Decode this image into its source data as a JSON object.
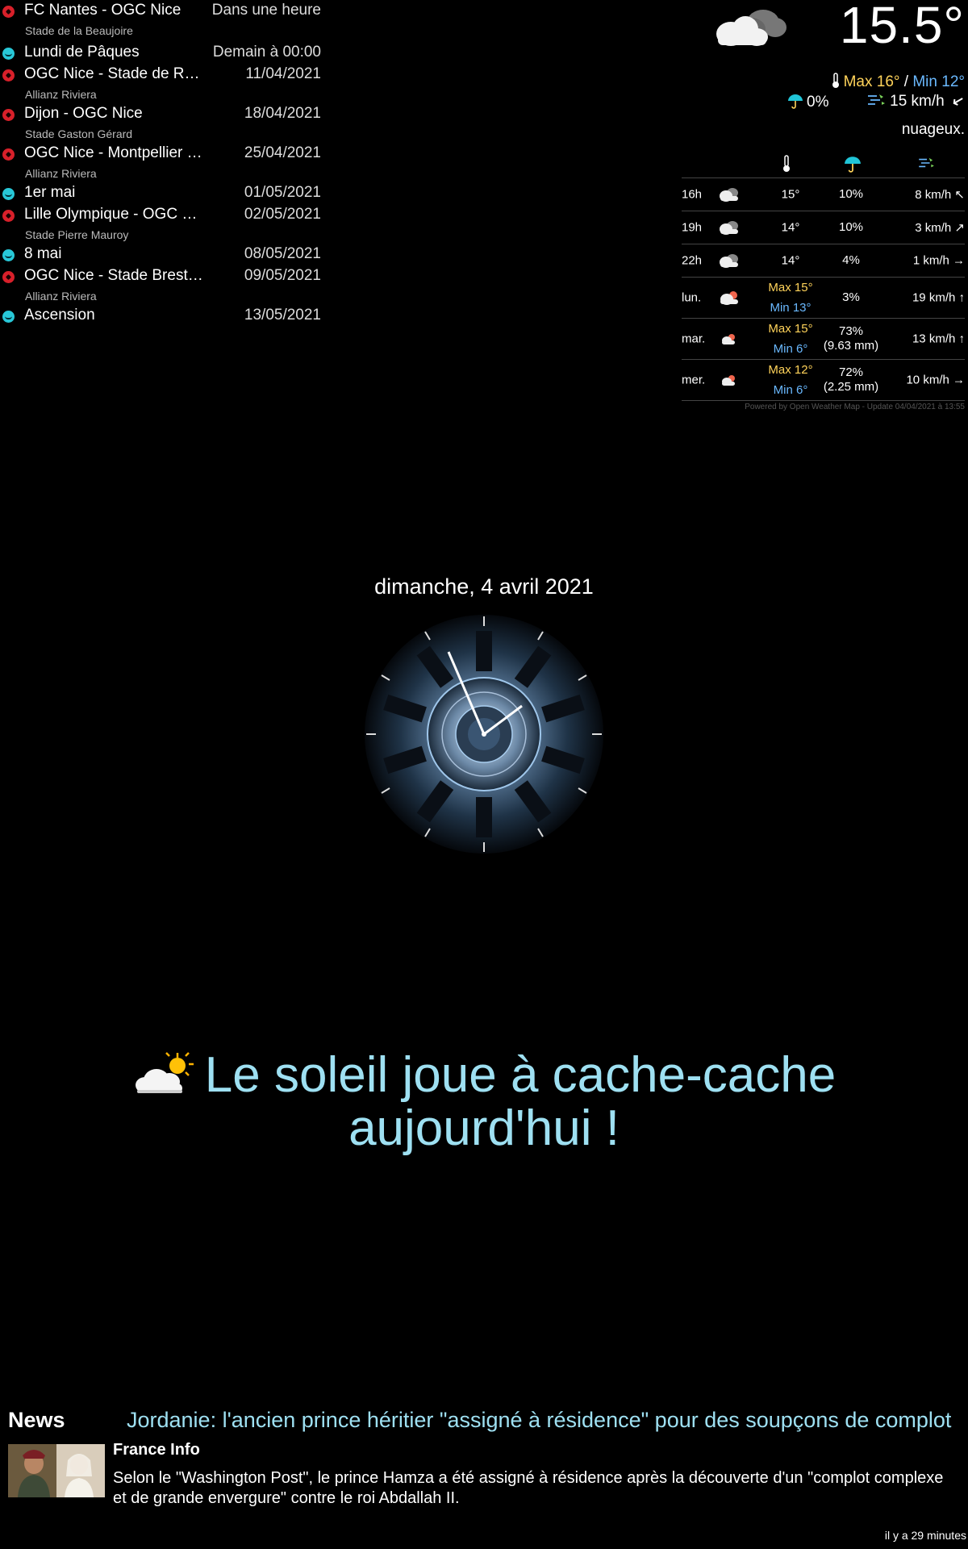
{
  "calendar": {
    "events": [
      {
        "type": "ball",
        "title": "FC Nantes - OGC Nice",
        "time": "Dans une heure",
        "location": "Stade de la Beaujoire"
      },
      {
        "type": "holiday",
        "title": "Lundi de Pâques",
        "time": "Demain à 00:00",
        "location": ""
      },
      {
        "type": "ball",
        "title": "OGC Nice - Stade de Reims",
        "time": "11/04/2021",
        "location": "Allianz Riviera"
      },
      {
        "type": "ball",
        "title": "Dijon - OGC Nice",
        "time": "18/04/2021",
        "location": "Stade Gaston Gérard"
      },
      {
        "type": "ball",
        "title": "OGC Nice - Montpellier Hé…",
        "time": "25/04/2021",
        "location": "Allianz Riviera"
      },
      {
        "type": "holiday",
        "title": "1er mai",
        "time": "01/05/2021",
        "location": ""
      },
      {
        "type": "ball",
        "title": "Lille Olympique - OGC Nic…",
        "time": "02/05/2021",
        "location": "Stade Pierre Mauroy"
      },
      {
        "type": "holiday",
        "title": "8 mai",
        "time": "08/05/2021",
        "location": ""
      },
      {
        "type": "ball",
        "title": "OGC Nice - Stade Brestois",
        "time": "09/05/2021",
        "location": "Allianz Riviera"
      },
      {
        "type": "holiday",
        "title": "Ascension",
        "time": "13/05/2021",
        "location": ""
      }
    ]
  },
  "current_weather": {
    "temperature": "15.5°",
    "max": "Max 16°",
    "separator": " / ",
    "min": "Min 12°",
    "rain": "0%",
    "wind": "15 km/h",
    "description": "nuageux.",
    "icon": "cloudy-icon"
  },
  "forecast": {
    "rows": [
      {
        "day": "16h",
        "max": "15°",
        "min": "",
        "rain": "10%",
        "rain_mm": "",
        "wind": "8 km/h",
        "icon": "cloudy-icon"
      },
      {
        "day": "19h",
        "max": "14°",
        "min": "",
        "rain": "10%",
        "rain_mm": "",
        "wind": "3 km/h",
        "icon": "cloudy-icon"
      },
      {
        "day": "22h",
        "max": "14°",
        "min": "",
        "rain": "4%",
        "rain_mm": "",
        "wind": "1 km/h",
        "icon": "cloudy-icon"
      },
      {
        "day": "lun.",
        "max": "Max 15°",
        "min": "Min 13°",
        "rain": "3%",
        "rain_mm": "",
        "wind": "19 km/h",
        "icon": "cloud-rain-icon"
      },
      {
        "day": "mar.",
        "max": "Max 15°",
        "min": "Min 6°",
        "rain": "73%",
        "rain_mm": "(9.63 mm)",
        "wind": "13 km/h",
        "icon": "cloud-rain-icon"
      },
      {
        "day": "mer.",
        "max": "Max 12°",
        "min": "Min 6°",
        "rain": "72%",
        "rain_mm": "(2.25 mm)",
        "wind": "10 km/h",
        "icon": "cloud-rain-icon"
      }
    ],
    "footer": "Powered by Open Weather Map - Update 04/04/2021 à 13:55"
  },
  "clock": {
    "date": "dimanche, 4 avril 2021"
  },
  "compliment": {
    "line1": "Le soleil joue à cache-cache",
    "line2": "aujourd'hui !"
  },
  "news": {
    "label": "News",
    "headline": "Jordanie: l'ancien prince héritier \"assigné à résidence\" pour des soupçons de complot",
    "source": "France Info",
    "description": "Selon le \"Washington Post\", le prince Hamza a été assigné à résidence après la découverte d'un \"complot complexe et de grande envergure\" contre le roi Abdallah II.",
    "age": "il y a 29 minutes"
  }
}
